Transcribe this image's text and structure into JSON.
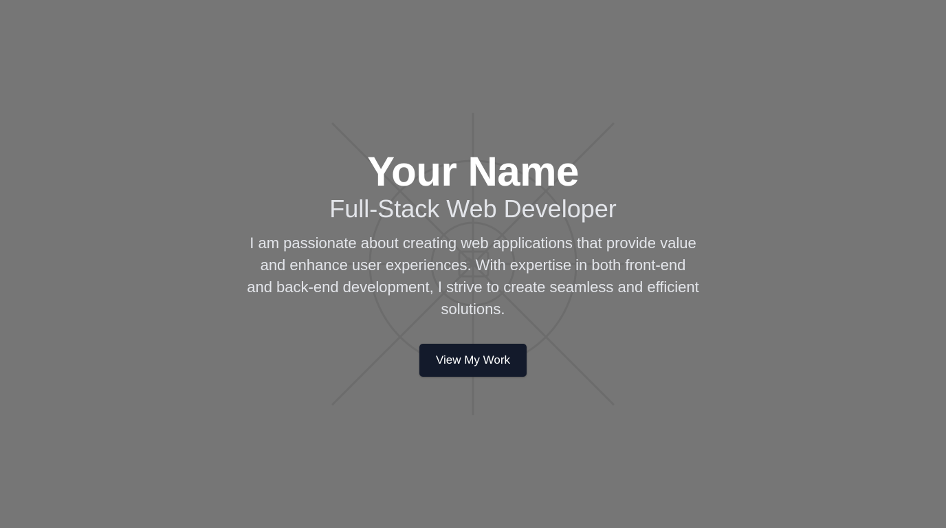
{
  "hero": {
    "name": "Your Name",
    "role": "Full-Stack Web Developer",
    "bio": "I am passionate about creating web applications that provide value and enhance user experiences. With expertise in both front-end and back-end development, I strive to create seamless and efficient solutions.",
    "cta_label": "View My Work",
    "background_icon": "image-placeholder-icon"
  },
  "colors": {
    "page_background": "#767676",
    "button_background": "#131a2b",
    "title_text": "#ffffff",
    "secondary_text": "#e3e5ea"
  }
}
